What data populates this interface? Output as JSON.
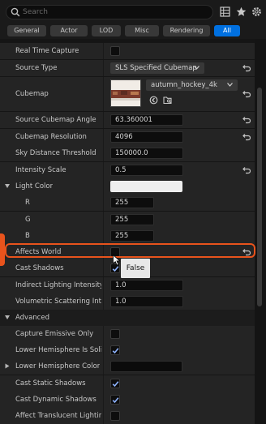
{
  "search": {
    "placeholder": "Search"
  },
  "toolbar": {
    "icons": [
      "grid-view-icon",
      "favorite-star-icon",
      "settings-gear-icon"
    ]
  },
  "tabs": [
    {
      "label": "General",
      "active": false
    },
    {
      "label": "Actor",
      "active": false
    },
    {
      "label": "LOD",
      "active": false
    },
    {
      "label": "Misc",
      "active": false
    },
    {
      "label": "Rendering",
      "active": false
    },
    {
      "label": "All",
      "active": true
    }
  ],
  "properties": {
    "real_time_capture": {
      "label": "Real Time Capture",
      "checked": false
    },
    "source_type": {
      "label": "Source Type",
      "value": "SLS Specified Cubemap"
    },
    "cubemap": {
      "label": "Cubemap",
      "value": "autumn_hockey_4k"
    },
    "source_cubemap_angle": {
      "label": "Source Cubemap Angle",
      "value": "63.360001"
    },
    "cubemap_resolution": {
      "label": "Cubemap Resolution",
      "value": "4096"
    },
    "sky_distance_threshold": {
      "label": "Sky Distance Threshold",
      "value": "150000.0"
    },
    "intensity_scale": {
      "label": "Intensity Scale",
      "value": "0.5"
    },
    "light_color": {
      "label": "Light Color",
      "color": "#eeeeee"
    },
    "r": {
      "label": "R",
      "value": "255"
    },
    "g": {
      "label": "G",
      "value": "255"
    },
    "b": {
      "label": "B",
      "value": "255"
    },
    "affects_world": {
      "label": "Affects World",
      "checked": false,
      "tooltip": "False"
    },
    "cast_shadows": {
      "label": "Cast Shadows",
      "checked": true
    },
    "indirect_lighting_intensity": {
      "label": "Indirect Lighting Intensity",
      "value": "1.0"
    },
    "volumetric_scattering_intensity": {
      "label": "Volumetric Scattering Inte...",
      "value": "1.0"
    }
  },
  "advanced": {
    "label": "Advanced",
    "capture_emissive_only": {
      "label": "Capture Emissive Only",
      "checked": false
    },
    "lower_hemisphere_is_solid": {
      "label": "Lower Hemisphere Is Solid...",
      "checked": true
    },
    "lower_hemisphere_color": {
      "label": "Lower Hemisphere Color",
      "color": "#0b0b0b"
    },
    "cast_static_shadows": {
      "label": "Cast Static Shadows",
      "checked": true
    },
    "cast_dynamic_shadows": {
      "label": "Cast Dynamic Shadows",
      "checked": true
    },
    "affect_translucent_lighting": {
      "label": "Affect Translucent Lighting",
      "checked": false
    }
  },
  "colors": {
    "accent": "#0070e0",
    "highlight": "#e8531c",
    "checkmark": "#8fb4ff"
  }
}
